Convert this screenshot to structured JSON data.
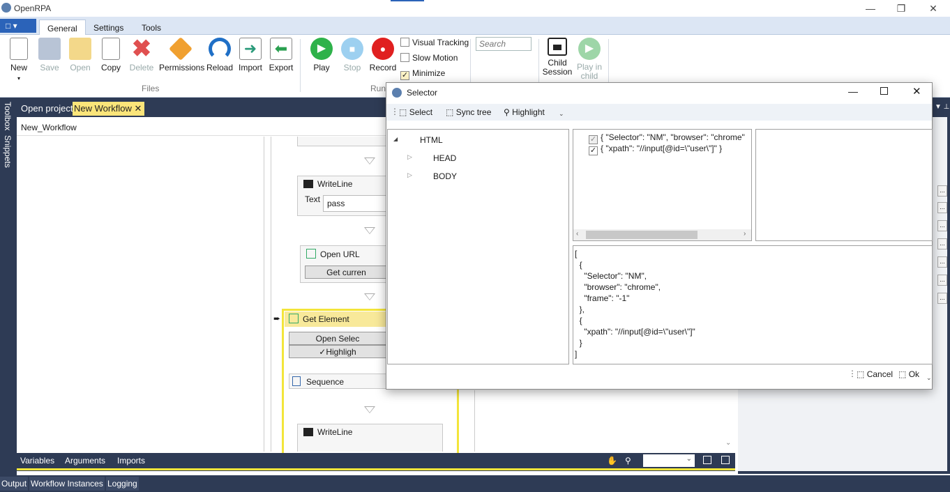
{
  "app": {
    "title": "OpenRPA"
  },
  "ribbon": {
    "tabs": [
      "General",
      "Settings",
      "Tools"
    ],
    "buttons": {
      "new": "New",
      "save": "Save",
      "open": "Open",
      "copy": "Copy",
      "delete": "Delete",
      "permissions": "Permissions",
      "reload": "Reload",
      "import": "Import",
      "export": "Export",
      "play": "Play",
      "stop": "Stop",
      "record": "Record",
      "child_session": "Child Session",
      "play_in_child": "Play in child"
    },
    "checks": {
      "visual_tracking": "Visual Tracking",
      "slow_motion": "Slow Motion",
      "minimize": "Minimize"
    },
    "search_placeholder": "Search",
    "groups": {
      "files": "Files",
      "run": "Run"
    }
  },
  "side": {
    "toolbox": "Toolbox",
    "snippets": "Snippets"
  },
  "doc_tabs": {
    "open_project": "Open project",
    "new_workflow": "New Workflow"
  },
  "breadcrumb": "New_Workflow",
  "workflow": {
    "writeline1": {
      "title": "WriteLine",
      "text_label": "Text",
      "text_value": "pass"
    },
    "openurl": {
      "title": "Open URL",
      "button": "Get curren"
    },
    "getelement": {
      "title": "Get Element",
      "open_selector": "Open Selec",
      "highlight": "Highligh"
    },
    "sequence": {
      "title": "Sequence"
    },
    "writeline2": {
      "title": "WriteLine"
    }
  },
  "bottom_tabs": [
    "Variables",
    "Arguments",
    "Imports"
  ],
  "output_tabs": [
    "Output",
    "Workflow Instances",
    "Logging"
  ],
  "dialog": {
    "title": "Selector",
    "toolbar": {
      "select": "Select",
      "sync_tree": "Sync tree",
      "highlight": "Highlight"
    },
    "tree": {
      "root": "HTML",
      "children": [
        "HEAD",
        "BODY"
      ]
    },
    "selector_items": [
      "{   \"Selector\": \"NM\",   \"browser\": \"chrome\"",
      "{   \"xpath\": \"//input[@id=\\\"user\\\"]\" }"
    ],
    "json_text": "[\n  {\n    \"Selector\": \"NM\",\n    \"browser\": \"chrome\",\n    \"frame\": \"-1\"\n  },\n  {\n    \"xpath\": \"//input[@id=\\\"user\\\"]\"\n  }\n]",
    "buttons": {
      "cancel": "Cancel",
      "ok": "Ok"
    }
  }
}
